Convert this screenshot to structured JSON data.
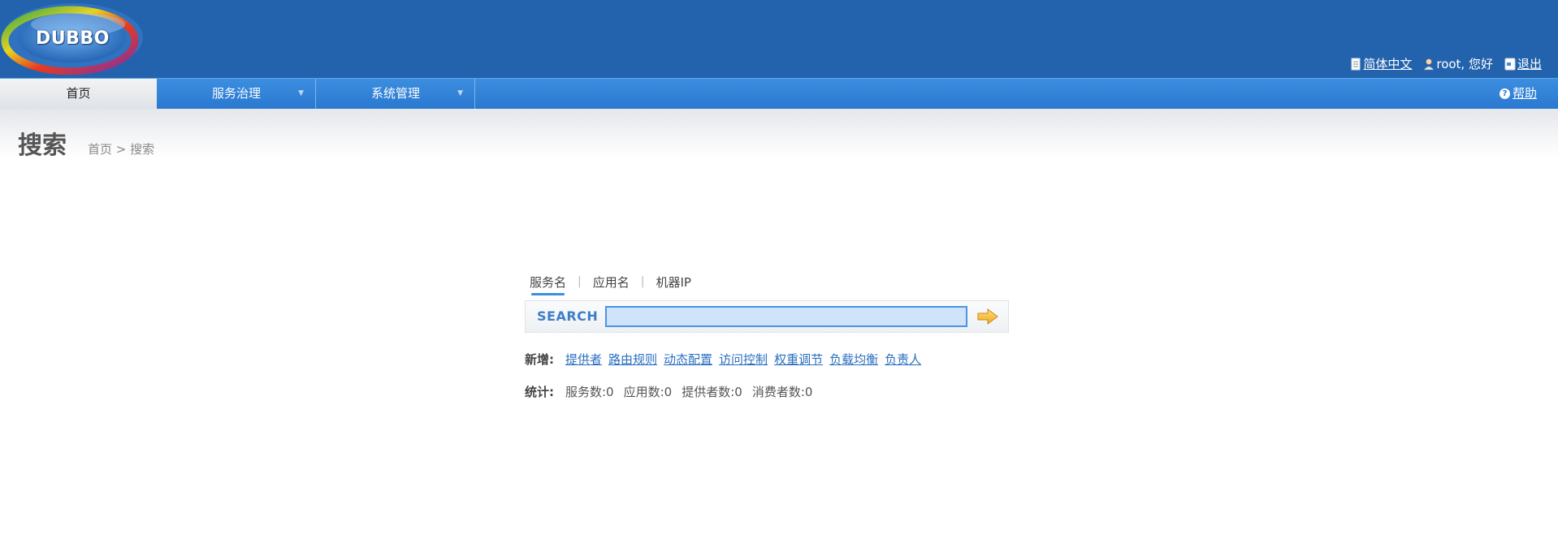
{
  "header": {
    "logo_text": "DUBBO",
    "language_label": "简体中文",
    "user_greeting": "root, 您好",
    "logout_label": "退出"
  },
  "nav": {
    "home_label": "首页",
    "service_governance_label": "服务治理",
    "system_management_label": "系统管理",
    "help_label": "帮助"
  },
  "page": {
    "title": "搜索",
    "breadcrumb": "首页 > 搜索"
  },
  "search": {
    "tabs": [
      "服务名",
      "应用名",
      "机器IP"
    ],
    "active_tab": 0,
    "label": "SEARCH",
    "value": "",
    "placeholder": ""
  },
  "add": {
    "label": "新增:",
    "links": [
      "提供者",
      "路由规则",
      "动态配置",
      "访问控制",
      "权重调节",
      "负载均衡",
      "负责人"
    ]
  },
  "stats": {
    "label": "统计:",
    "items": [
      "服务数:0",
      "应用数:0",
      "提供者数:0",
      "消费者数:0"
    ]
  },
  "colors": {
    "header_bg": "#2363ad",
    "nav_bg": "#2a78d0",
    "link": "#2a6fbf",
    "accent": "#3c8ee0"
  }
}
